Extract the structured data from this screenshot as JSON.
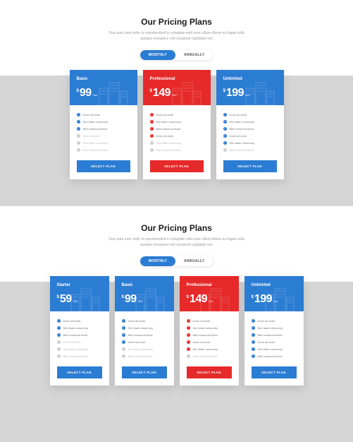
{
  "header": {
    "title": "Our Pricing Plans",
    "subtitle": "Duis aute irure dolor in reprehenderit in voluptate velit esse cillum dolore eu fugiat nulla pariatur excepteur sint occaecat cupidatat non"
  },
  "toggle": {
    "monthly": "MONTHLY",
    "annually": "ANNUALLY"
  },
  "currency": "$",
  "period": "/mo",
  "cta": "SELECT PLAN",
  "section1": {
    "plans": [
      {
        "name": "Basic",
        "price": "99",
        "color": "blue",
        "features": [
          {
            "t": "Dolor sit amet",
            "on": true
          },
          {
            "t": "Sed diam nonummy",
            "on": true
          },
          {
            "t": "Nibh euismod tincid",
            "on": true
          },
          {
            "t": "Dolor sit amet",
            "on": false
          },
          {
            "t": "Sed diam nonummy",
            "on": false
          },
          {
            "t": "Nibh euismod tincid",
            "on": false
          }
        ]
      },
      {
        "name": "Professional",
        "price": "149",
        "color": "red",
        "features": [
          {
            "t": "Dolor sit amet",
            "on": true
          },
          {
            "t": "Sed diam nonummy",
            "on": true
          },
          {
            "t": "Nibh euismod tincid",
            "on": true
          },
          {
            "t": "Dolor sit amet",
            "on": true
          },
          {
            "t": "Sed diam nonummy",
            "on": false
          },
          {
            "t": "Nibh euismod tincid",
            "on": false
          }
        ]
      },
      {
        "name": "Unlimited",
        "price": "199",
        "color": "blue",
        "features": [
          {
            "t": "Dolor sit amet",
            "on": true
          },
          {
            "t": "Sed diam nonummy",
            "on": true
          },
          {
            "t": "Nibh euismod tincid",
            "on": true
          },
          {
            "t": "Dolor sit amet",
            "on": true
          },
          {
            "t": "Sed diam nonummy",
            "on": true
          },
          {
            "t": "Nibh euismod tincid",
            "on": false
          }
        ]
      }
    ]
  },
  "section2": {
    "plans": [
      {
        "name": "Starter",
        "price": "59",
        "color": "blue",
        "features": [
          {
            "t": "Dolor sit amet",
            "on": true
          },
          {
            "t": "Sed diam nonummy",
            "on": true
          },
          {
            "t": "Nibh euismod tincid",
            "on": true
          },
          {
            "t": "Dolor sit amet",
            "on": false
          },
          {
            "t": "Sed diam nonummy",
            "on": false
          },
          {
            "t": "Nibh euismod tincid",
            "on": false
          }
        ]
      },
      {
        "name": "Basic",
        "price": "99",
        "color": "blue",
        "features": [
          {
            "t": "Dolor sit amet",
            "on": true
          },
          {
            "t": "Sed diam nonummy",
            "on": true
          },
          {
            "t": "Nibh euismod tincid",
            "on": true
          },
          {
            "t": "Dolor sit amet",
            "on": true
          },
          {
            "t": "Sed diam nonummy",
            "on": false
          },
          {
            "t": "Nibh euismod tincid",
            "on": false
          }
        ]
      },
      {
        "name": "Professional",
        "price": "149",
        "color": "red",
        "features": [
          {
            "t": "Dolor sit amet",
            "on": true
          },
          {
            "t": "Sed diam nonummy",
            "on": true
          },
          {
            "t": "Nibh euismod tincid",
            "on": true
          },
          {
            "t": "Dolor sit amet",
            "on": true
          },
          {
            "t": "Sed diam nonummy",
            "on": true
          },
          {
            "t": "Nibh euismod tincid",
            "on": false
          }
        ]
      },
      {
        "name": "Unlimited",
        "price": "199",
        "color": "blue",
        "features": [
          {
            "t": "Dolor sit amet",
            "on": true
          },
          {
            "t": "Sed diam nonummy",
            "on": true
          },
          {
            "t": "Nibh euismod tincid",
            "on": true
          },
          {
            "t": "Dolor sit amet",
            "on": true
          },
          {
            "t": "Sed diam nonummy",
            "on": true
          },
          {
            "t": "Nibh euismod tincid",
            "on": true
          }
        ]
      }
    ]
  }
}
